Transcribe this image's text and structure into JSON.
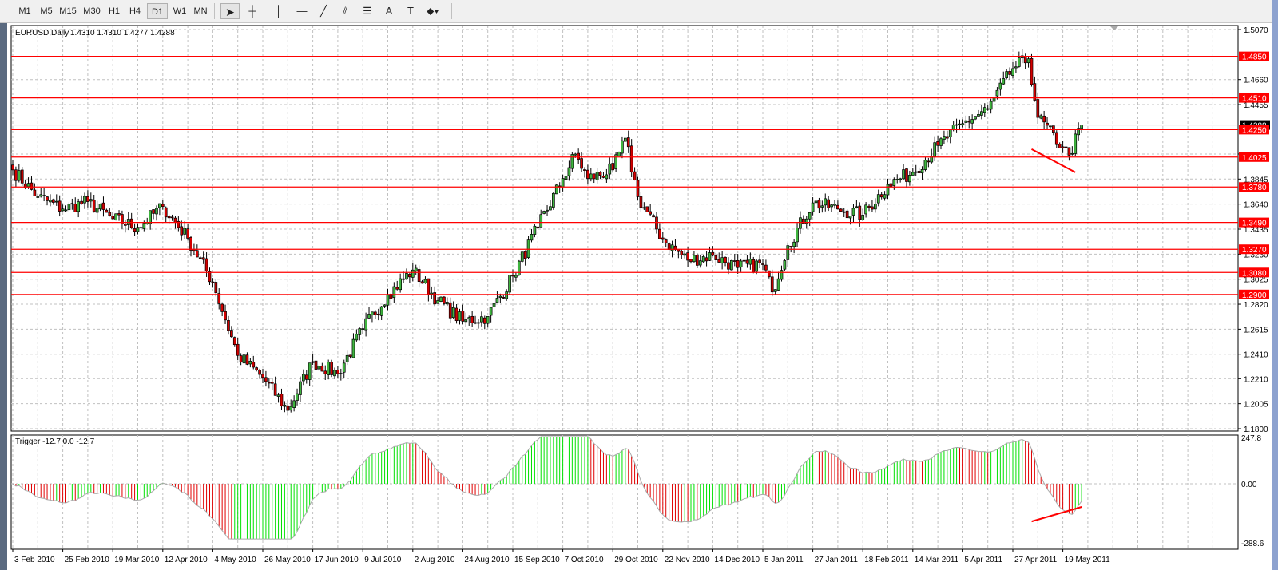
{
  "toolbar": {
    "timeframes": [
      "M1",
      "M5",
      "M15",
      "M30",
      "H1",
      "H4",
      "D1",
      "W1",
      "MN"
    ],
    "active_timeframe": "D1",
    "tools": [
      {
        "name": "cursor-arrow-icon",
        "glyph": "➤"
      },
      {
        "name": "crosshair-icon",
        "glyph": "┼"
      },
      {
        "name": "vertical-line-icon",
        "glyph": "│"
      },
      {
        "name": "horizontal-line-icon",
        "glyph": "—"
      },
      {
        "name": "trendline-icon",
        "glyph": "╱"
      },
      {
        "name": "equidistant-channel-icon",
        "glyph": "⫽"
      },
      {
        "name": "fibonacci-icon",
        "glyph": "☰"
      },
      {
        "name": "text-icon",
        "glyph": "A"
      },
      {
        "name": "text-label-icon",
        "glyph": "T"
      },
      {
        "name": "arrows-dropdown-icon",
        "glyph": "⬥▾"
      }
    ]
  },
  "chart": {
    "title": "EURUSD,Daily",
    "ohlc_text": "1.4310 1.4310 1.4277 1.4288",
    "current_price": "1.4288",
    "colors": {
      "bull": "#3fb43f",
      "bear": "#d40000",
      "level": "#ff0000",
      "grid": "#c0c0c0",
      "indicator_up": "#00e000",
      "indicator_down": "#e00000"
    }
  },
  "chart_data": [
    {
      "type": "candlestick",
      "symbol": "EURUSD",
      "timeframe": "Daily",
      "ylim": [
        1.18,
        1.507
      ],
      "y_ticks": [
        "1.5070",
        "1.4660",
        "1.4455",
        "1.4050",
        "1.3845",
        "1.3640",
        "1.3435",
        "1.3230",
        "1.3025",
        "1.2820",
        "1.2615",
        "1.2410",
        "1.2210",
        "1.2005",
        "1.1800"
      ],
      "x_ticks": [
        "3 Feb 2010",
        "25 Feb 2010",
        "19 Mar 2010",
        "12 Apr 2010",
        "4 May 2010",
        "26 May 2010",
        "17 Jun 2010",
        "9 Jul 2010",
        "2 Aug 2010",
        "24 Aug 2010",
        "15 Sep 2010",
        "7 Oct 2010",
        "29 Oct 2010",
        "22 Nov 2010",
        "14 Dec 2010",
        "5 Jan 2011",
        "27 Jan 2011",
        "18 Feb 2011",
        "14 Mar 2011",
        "5 Apr 2011",
        "27 Apr 2011",
        "19 May 2011"
      ],
      "grid": true,
      "approx_close_path": [
        [
          "2010-02-03",
          1.392
        ],
        [
          "2010-02-15",
          1.37
        ],
        [
          "2010-02-25",
          1.36
        ],
        [
          "2010-03-09",
          1.366
        ],
        [
          "2010-03-19",
          1.352
        ],
        [
          "2010-03-31",
          1.345
        ],
        [
          "2010-04-12",
          1.362
        ],
        [
          "2010-04-22",
          1.336
        ],
        [
          "2010-05-04",
          1.3
        ],
        [
          "2010-05-14",
          1.24
        ],
        [
          "2010-05-26",
          1.222
        ],
        [
          "2010-06-07",
          1.195
        ],
        [
          "2010-06-17",
          1.235
        ],
        [
          "2010-06-29",
          1.225
        ],
        [
          "2010-07-09",
          1.262
        ],
        [
          "2010-07-21",
          1.29
        ],
        [
          "2010-08-02",
          1.31
        ],
        [
          "2010-08-12",
          1.285
        ],
        [
          "2010-08-24",
          1.268
        ],
        [
          "2010-09-03",
          1.272
        ],
        [
          "2010-09-15",
          1.305
        ],
        [
          "2010-09-27",
          1.345
        ],
        [
          "2010-10-07",
          1.385
        ],
        [
          "2010-10-13",
          1.405
        ],
        [
          "2010-10-19",
          1.385
        ],
        [
          "2010-10-29",
          1.392
        ],
        [
          "2010-11-04",
          1.418
        ],
        [
          "2010-11-10",
          1.37
        ],
        [
          "2010-11-22",
          1.335
        ],
        [
          "2010-12-02",
          1.318
        ],
        [
          "2010-12-14",
          1.322
        ],
        [
          "2010-12-24",
          1.312
        ],
        [
          "2011-01-05",
          1.315
        ],
        [
          "2011-01-10",
          1.292
        ],
        [
          "2011-01-17",
          1.33
        ],
        [
          "2011-01-27",
          1.365
        ],
        [
          "2011-02-08",
          1.36
        ],
        [
          "2011-02-18",
          1.355
        ],
        [
          "2011-03-02",
          1.38
        ],
        [
          "2011-03-14",
          1.39
        ],
        [
          "2011-03-24",
          1.412
        ],
        [
          "2011-04-05",
          1.43
        ],
        [
          "2011-04-15",
          1.442
        ],
        [
          "2011-04-27",
          1.475
        ],
        [
          "2011-05-04",
          1.483
        ],
        [
          "2011-05-09",
          1.435
        ],
        [
          "2011-05-19",
          1.41
        ],
        [
          "2011-05-23",
          1.404
        ],
        [
          "2011-05-27",
          1.4288
        ]
      ],
      "levels": [
        1.485,
        1.451,
        1.425,
        1.4025,
        1.378,
        1.349,
        1.327,
        1.308,
        1.29
      ],
      "level_labels": [
        "1.4850",
        "1.4510",
        "1.4250",
        "1.4025",
        "1.3780",
        "1.3490",
        "1.3270",
        "1.3080",
        "1.2900"
      ],
      "trendline": {
        "from": [
          "2011-05-05",
          1.409
        ],
        "to": [
          "2011-05-25",
          1.39
        ],
        "color": "#ff0000"
      }
    },
    {
      "type": "histogram",
      "indicator": "Trigger",
      "legend_text": "Trigger -12.7 0.0 -12.7",
      "ylim": [
        -288.6,
        247.8
      ],
      "y_ticks": [
        "247.8",
        "0.00",
        "-288.6"
      ],
      "trendline": {
        "from": [
          "2011-05-05",
          -190
        ],
        "to": [
          "2011-05-27",
          -117
        ],
        "color": "#ff0000"
      }
    }
  ]
}
